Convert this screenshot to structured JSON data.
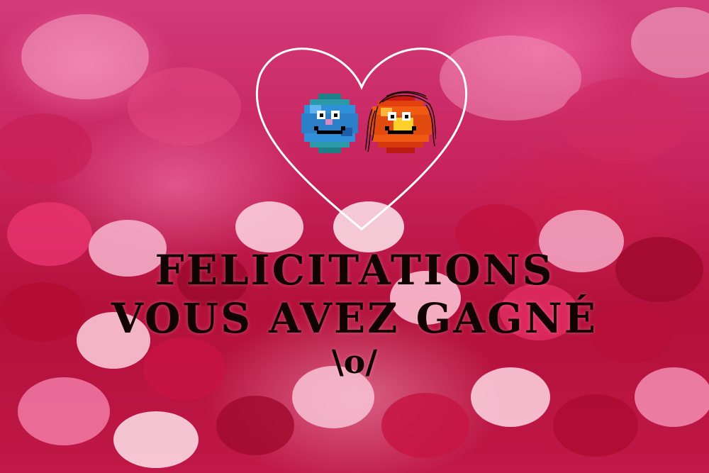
{
  "title": {
    "line1": "FELICITATIONS",
    "line2": "VOUS AVEZ GAGNÉ",
    "line3": "\\o/"
  },
  "colors": {
    "background": "#c8245e",
    "heart_outline": "#ffffff",
    "text": "#120305",
    "blue_character": "#2f8fd8",
    "orange_character": "#f05a12"
  },
  "icons": {
    "frame": "heart-outline-icon",
    "left_character": "blue-smiley-icon",
    "right_character": "orange-smiley-icon"
  }
}
